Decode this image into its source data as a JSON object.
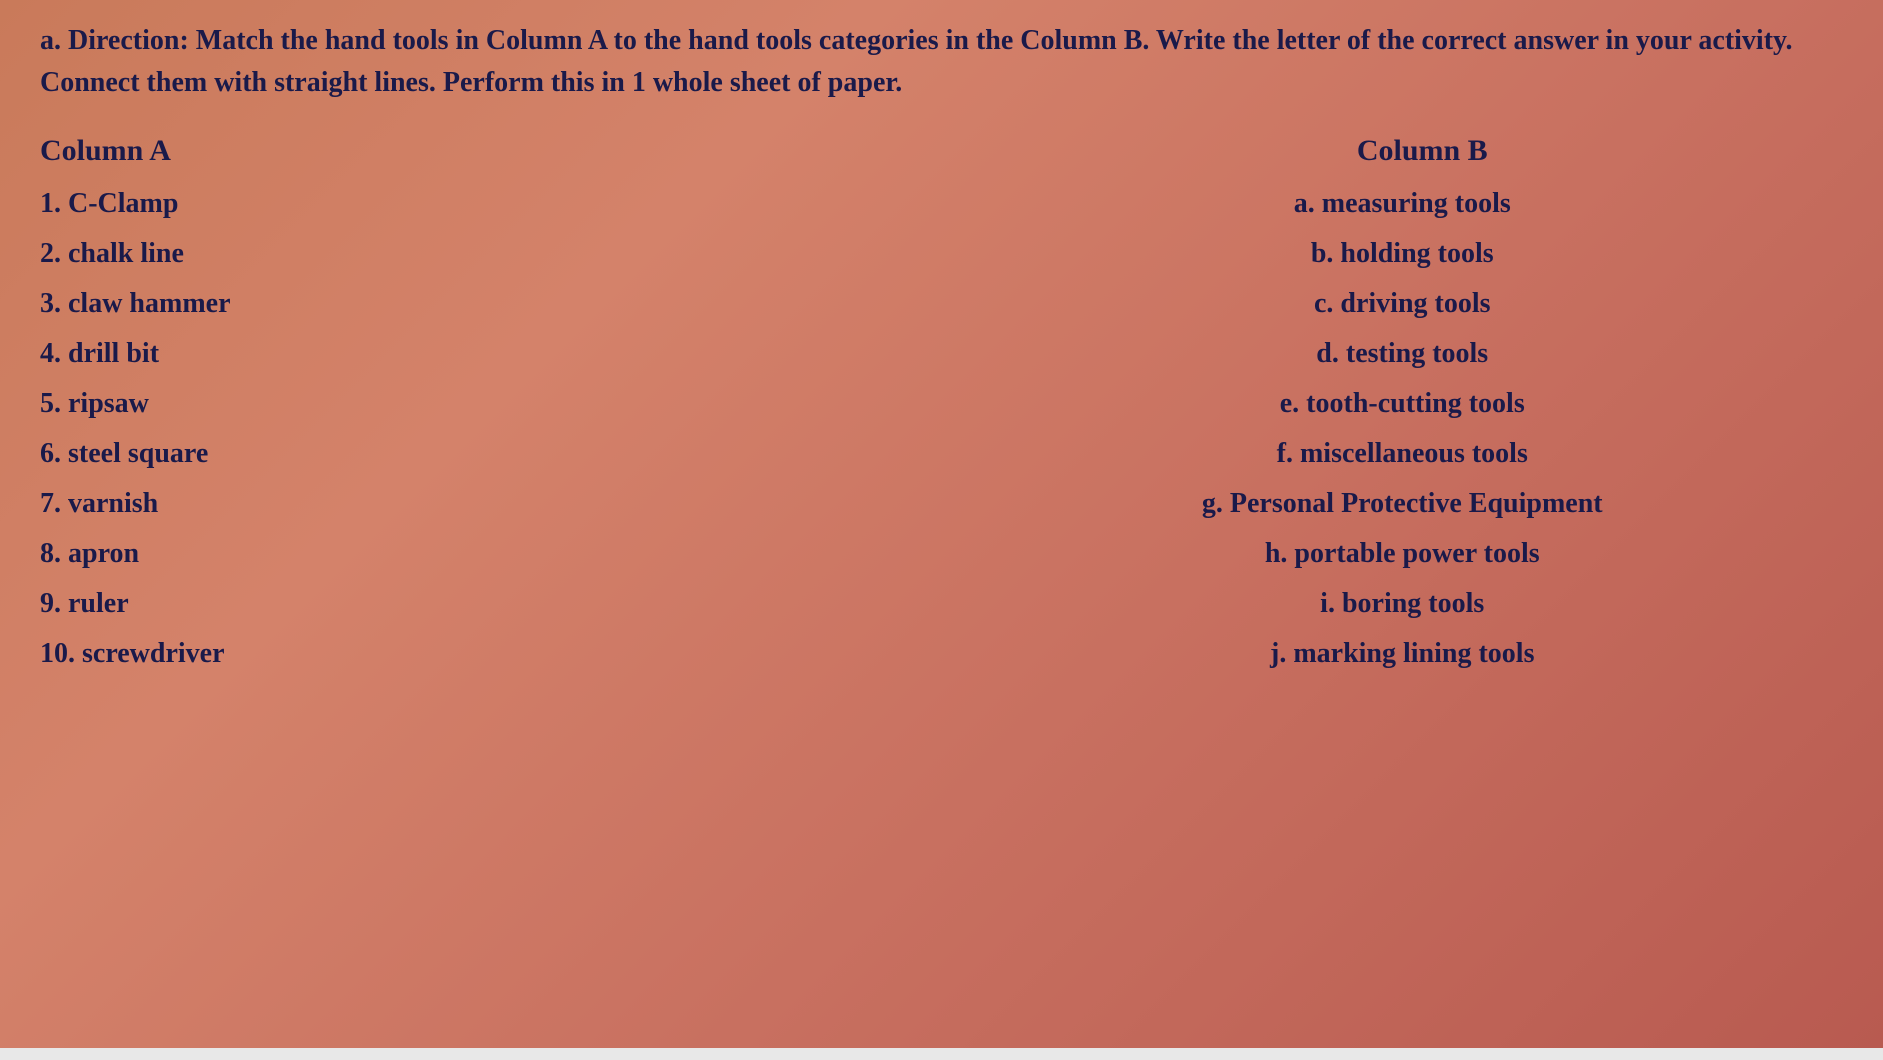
{
  "directions": {
    "text": "a. Direction: Match the hand tools in Column A to the hand tools categories in the Column B. Write the letter of the correct answer in your activity. Connect them with straight lines. Perform this in 1 whole sheet of paper."
  },
  "columnA": {
    "header": "Column A",
    "items": [
      {
        "id": 1,
        "label": "1. C-Clamp"
      },
      {
        "id": 2,
        "label": "2. chalk line"
      },
      {
        "id": 3,
        "label": "3. claw hammer"
      },
      {
        "id": 4,
        "label": "4. drill bit"
      },
      {
        "id": 5,
        "label": "5. ripsaw"
      },
      {
        "id": 6,
        "label": "6. steel square"
      },
      {
        "id": 7,
        "label": "7. varnish"
      },
      {
        "id": 8,
        "label": "8. apron"
      },
      {
        "id": 9,
        "label": "9. ruler"
      },
      {
        "id": 10,
        "label": "10. screwdriver"
      }
    ]
  },
  "columnB": {
    "header": "Column B",
    "items": [
      {
        "id": "a",
        "label": "a. measuring tools"
      },
      {
        "id": "b",
        "label": "b. holding tools"
      },
      {
        "id": "c",
        "label": "c. driving tools"
      },
      {
        "id": "d",
        "label": "d. testing tools"
      },
      {
        "id": "e",
        "label": "e. tooth-cutting tools"
      },
      {
        "id": "f",
        "label": "f. miscellaneous tools"
      },
      {
        "id": "g",
        "label": "g. Personal Protective Equipment"
      },
      {
        "id": "h",
        "label": "h. portable power tools"
      },
      {
        "id": "i",
        "label": "i. boring tools"
      },
      {
        "id": "j",
        "label": "j. marking lining tools"
      }
    ]
  }
}
